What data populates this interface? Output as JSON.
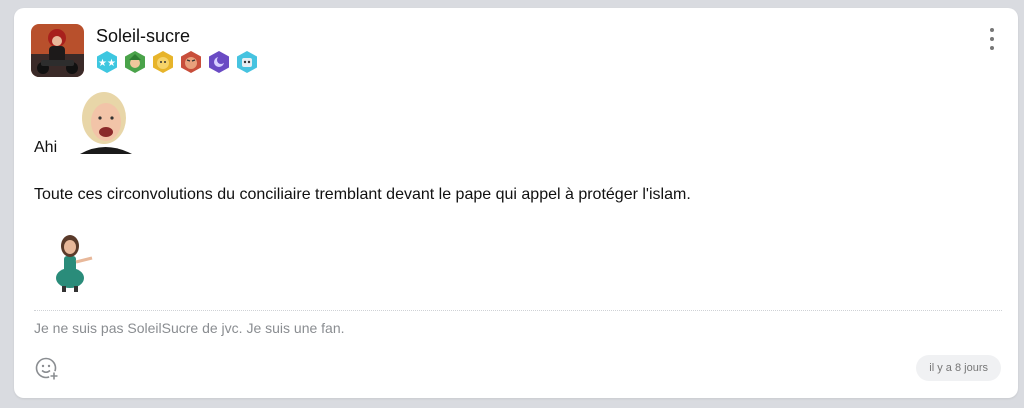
{
  "post": {
    "username": "Soleil-sucre",
    "badges": [
      {
        "icon": "stars-badge-icon",
        "color": "#3ec7e0"
      },
      {
        "icon": "elf-badge-icon",
        "color": "#4aa34a"
      },
      {
        "icon": "face-badge-icon",
        "color": "#e7b42a"
      },
      {
        "icon": "angry-face-badge-icon",
        "color": "#c84e3b"
      },
      {
        "icon": "moon-badge-icon",
        "color": "#6a4bc4"
      },
      {
        "icon": "robot-badge-icon",
        "color": "#46c3e0"
      }
    ],
    "line1": "Ahi",
    "body": "Toute ces circonvolutions du conciliaire tremblant devant le pape qui appel à protéger l'islam.",
    "signature": "Je ne suis pas SoleilSucre de jvc. Je suis une fan.",
    "timestamp": "il y a 8 jours"
  }
}
